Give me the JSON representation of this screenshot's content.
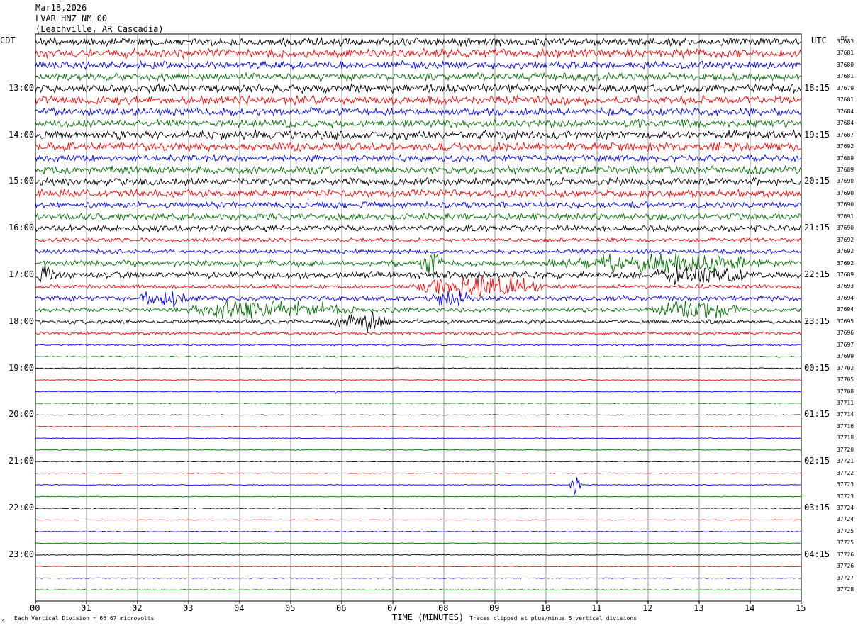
{
  "header": {
    "date": "Mar18,2026",
    "station": "LVAR HNZ NM 00",
    "location": "(Leachville, AR Cascadia)"
  },
  "labels": {
    "left_tz": "CDT",
    "right_tz": "UTC",
    "dc_label": "DC",
    "xlabel": "TIME (MINUTES)",
    "footer_left": "Each Vertical Division =   66.67 microvolts",
    "footer_right": "Traces clipped at plus/minus 5 vertical divisions",
    "corner_mark": "^"
  },
  "chart_data": {
    "type": "line",
    "title": "LVAR HNZ NM 00",
    "xlabel": "TIME (MINUTES)",
    "x_ticks": [
      "00",
      "01",
      "02",
      "03",
      "04",
      "05",
      "06",
      "07",
      "08",
      "09",
      "10",
      "11",
      "12",
      "13",
      "14",
      "15"
    ],
    "xlim": [
      0,
      15
    ],
    "trace_colors": [
      "#000000",
      "#ff0000",
      "#0000ff",
      "#007000"
    ],
    "left_hour_labels": [
      "13:00",
      "14:00",
      "15:00",
      "16:00",
      "17:00",
      "18:00",
      "19:00",
      "20:00",
      "21:00",
      "22:00",
      "23:00"
    ],
    "right_hour_labels": [
      "18:15",
      "19:15",
      "20:15",
      "21:15",
      "22:15",
      "23:15",
      "00:15",
      "01:15",
      "02:15",
      "03:15",
      "04:15"
    ],
    "dc_offsets": [
      37683,
      37681,
      37680,
      37681,
      37679,
      37681,
      37684,
      37684,
      37687,
      37692,
      37689,
      37689,
      37690,
      37690,
      37690,
      37691,
      37690,
      37692,
      37692,
      37692,
      37689,
      37693,
      37694,
      37694,
      37695,
      37696,
      37697,
      37699,
      37702,
      37705,
      37708,
      37711,
      37714,
      37716,
      37718,
      37720,
      37721,
      37722,
      37723,
      37723,
      37724,
      37724,
      37725,
      37725,
      37726,
      37726,
      37727,
      37728
    ],
    "noise_levels": [
      1.0,
      1.0,
      0.9,
      0.9,
      1.0,
      1.0,
      0.9,
      0.9,
      1.0,
      1.0,
      0.8,
      0.9,
      0.9,
      0.9,
      0.7,
      0.8,
      0.8,
      0.5,
      0.5,
      0.7,
      0.8,
      0.5,
      0.6,
      0.5,
      0.45,
      0.35,
      0.2,
      0.15,
      0.12,
      0.1,
      0.1,
      0.1,
      0.1,
      0.1,
      0.1,
      0.1,
      0.1,
      0.1,
      0.1,
      0.1,
      0.1,
      0.1,
      0.1,
      0.1,
      0.1,
      0.1,
      0.1,
      0.1
    ],
    "events": [
      {
        "trace": 20,
        "start_min": 0.0,
        "end_min": 0.5,
        "amp": 2.0
      },
      {
        "trace": 21,
        "start_min": 7.3,
        "end_min": 10.1,
        "amp": 2.5
      },
      {
        "trace": 22,
        "start_min": 2.0,
        "end_min": 3.0,
        "amp": 2.0
      },
      {
        "trace": 22,
        "start_min": 7.6,
        "end_min": 8.6,
        "amp": 1.8
      },
      {
        "trace": 23,
        "start_min": 2.5,
        "end_min": 6.5,
        "amp": 2.0
      },
      {
        "trace": 23,
        "start_min": 12.0,
        "end_min": 14.0,
        "amp": 2.2
      },
      {
        "trace": 24,
        "start_min": 5.7,
        "end_min": 7.0,
        "amp": 2.2
      },
      {
        "trace": 19,
        "start_min": 7.5,
        "end_min": 8.0,
        "amp": 3.0
      },
      {
        "trace": 19,
        "start_min": 10.0,
        "end_min": 14.5,
        "amp": 1.8
      },
      {
        "trace": 20,
        "start_min": 12.0,
        "end_min": 14.0,
        "amp": 1.8
      },
      {
        "trace": 30,
        "start_min": 5.85,
        "end_min": 5.9,
        "amp": 1.2
      },
      {
        "trace": 38,
        "start_min": 10.45,
        "end_min": 10.7,
        "amp": 2.5
      }
    ]
  }
}
